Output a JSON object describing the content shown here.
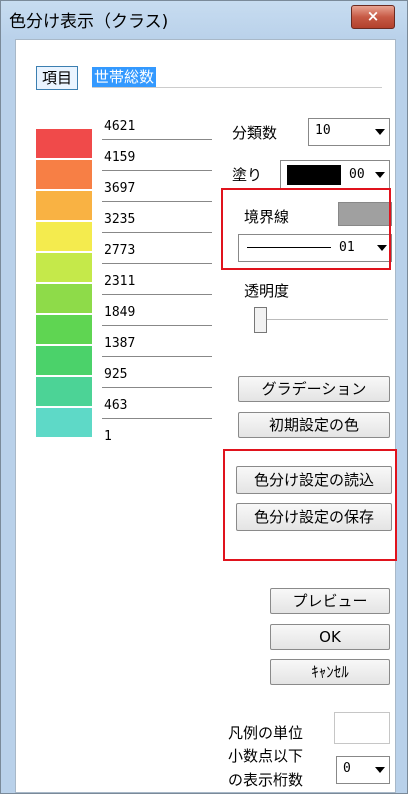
{
  "window": {
    "title": "色分け表示（クラス)",
    "close_symbol": "×"
  },
  "header": {
    "item_button": "項目",
    "field_name": "世帯総数"
  },
  "legend": [
    {
      "value": "4621",
      "color": "#f04a4a"
    },
    {
      "value": "4159",
      "color": "#f77f45"
    },
    {
      "value": "3697",
      "color": "#f9b243"
    },
    {
      "value": "3235",
      "color": "#f4eb4e"
    },
    {
      "value": "2773",
      "color": "#c5e94a"
    },
    {
      "value": "2311",
      "color": "#8edb49"
    },
    {
      "value": "1849",
      "color": "#5fd552"
    },
    {
      "value": "1387",
      "color": "#4bd26a"
    },
    {
      "value": "925",
      "color": "#4cd396"
    },
    {
      "value": "463",
      "color": "#5ed9c7"
    },
    {
      "value": "1",
      "color": ""
    }
  ],
  "classes": {
    "label": "分類数",
    "value": "10"
  },
  "fill": {
    "label": "塗り",
    "value": "00",
    "color": "#000000"
  },
  "border": {
    "label": "境界線",
    "line_value": "01",
    "color": "#a0a0a0"
  },
  "transparency": {
    "label": "透明度"
  },
  "buttons": {
    "gradation": "グラデーション",
    "initial_color": "初期設定の色",
    "load_settings": "色分け設定の読込",
    "save_settings": "色分け設定の保存",
    "preview": "プレビュー",
    "ok": "OK",
    "cancel": "ｷｬﾝｾﾙ"
  },
  "legend_unit": {
    "label": "凡例の単位",
    "value": ""
  },
  "decimals": {
    "label_line1": "小数点以下",
    "label_line2": "の表示桁数",
    "value": "0"
  },
  "highlight_color": "#e0131d"
}
